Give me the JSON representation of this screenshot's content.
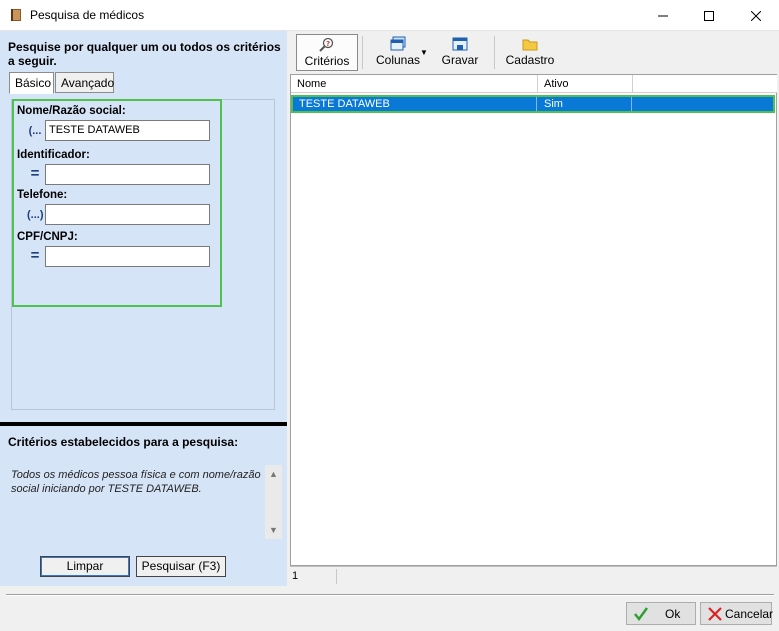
{
  "window": {
    "title": "Pesquisa de médicos"
  },
  "left": {
    "intro": "Pesquise por qualquer um ou todos os critérios a seguir.",
    "tabs": [
      "Básico",
      "Avançado"
    ],
    "fields": [
      {
        "label": "Nome/Razão social:",
        "operator": "(...",
        "value": "TESTE DATAWEB"
      },
      {
        "label": "Identificador:",
        "operator": "=",
        "value": ""
      },
      {
        "label": "Telefone:",
        "operator": "(...)",
        "value": ""
      },
      {
        "label": "CPF/CNPJ:",
        "operator": "=",
        "value": ""
      }
    ],
    "criteria_title": "Critérios estabelecidos para a pesquisa:",
    "criteria_text": "Todos os médicos pessoa física e com nome/razão social iniciando por TESTE DATAWEB.",
    "buttons": {
      "clear": "Limpar",
      "search": "Pesquisar (F3)"
    }
  },
  "toolbar": {
    "criterios": "Critérios",
    "colunas": "Colunas",
    "gravar": "Gravar",
    "cadastro": "Cadastro"
  },
  "grid": {
    "columns": [
      "Nome",
      "Ativo"
    ],
    "rows": [
      {
        "nome": "TESTE DATAWEB",
        "ativo": "Sim"
      }
    ]
  },
  "status": {
    "count": "1"
  },
  "dialog": {
    "ok": "Ok",
    "cancel": "Cancelar"
  }
}
